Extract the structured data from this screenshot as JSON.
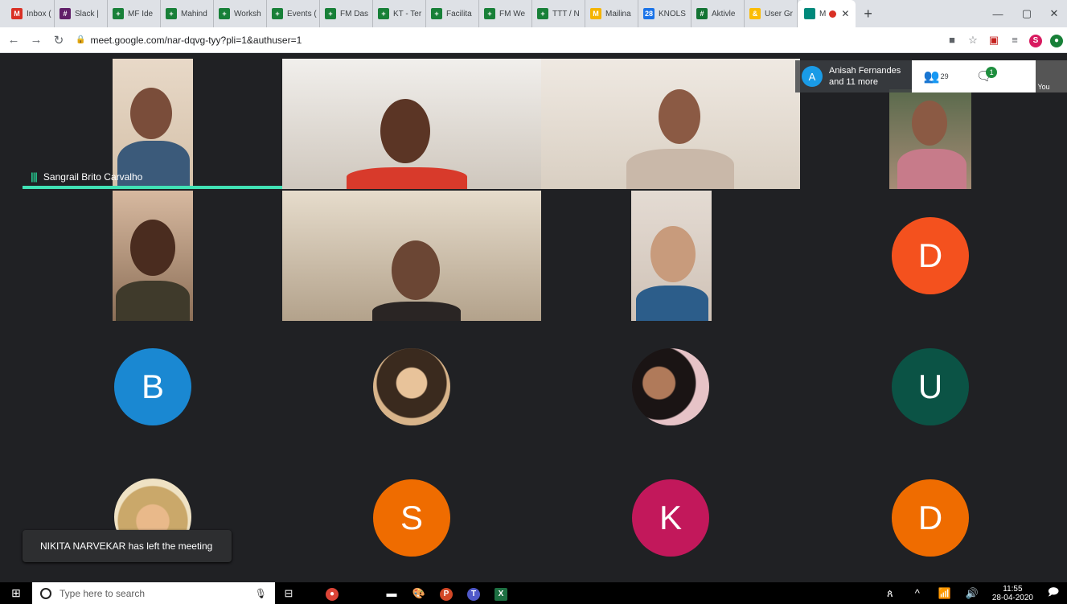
{
  "browser": {
    "tabs": [
      {
        "label": "Inbox (",
        "icon": "gmail-icon",
        "color": "#d93025",
        "glyph": "M"
      },
      {
        "label": "Slack | ",
        "icon": "slack-icon",
        "color": "#611f69",
        "glyph": "#"
      },
      {
        "label": "MF Ide",
        "icon": "sheets-icon",
        "color": "#188038",
        "glyph": "+"
      },
      {
        "label": "Mahind",
        "icon": "sheets-icon",
        "color": "#188038",
        "glyph": "+"
      },
      {
        "label": "Worksh",
        "icon": "sheets-icon",
        "color": "#188038",
        "glyph": "+"
      },
      {
        "label": "Events (",
        "icon": "sheets-icon",
        "color": "#188038",
        "glyph": "+"
      },
      {
        "label": "FM Das",
        "icon": "sheets-icon",
        "color": "#188038",
        "glyph": "+"
      },
      {
        "label": "KT - Ter",
        "icon": "sheets-icon",
        "color": "#188038",
        "glyph": "+"
      },
      {
        "label": "Facilita",
        "icon": "sheets-icon",
        "color": "#188038",
        "glyph": "+"
      },
      {
        "label": "FM We",
        "icon": "sheets-icon",
        "color": "#188038",
        "glyph": "+"
      },
      {
        "label": "TTT / N",
        "icon": "sheets-icon",
        "color": "#188038",
        "glyph": "+"
      },
      {
        "label": "Mailina",
        "icon": "mail-icon",
        "color": "#f4b400",
        "glyph": "M"
      },
      {
        "label": "KNOLS",
        "icon": "calendar-icon",
        "color": "#1a73e8",
        "glyph": "28"
      },
      {
        "label": "Aktivle",
        "icon": "app-icon",
        "color": "#137333",
        "glyph": "#"
      },
      {
        "label": "User Gr",
        "icon": "users-icon",
        "color": "#fbbc04",
        "glyph": "&"
      }
    ],
    "active_tab": {
      "label": "M",
      "icon": "meet-icon",
      "color": "#00897b"
    },
    "new_tab": "+",
    "url": "meet.google.com/nar-dqvg-tyy?pli=1&authuser=1",
    "profile_letter": "S"
  },
  "meet": {
    "active_speaker": "Sangrail Brito Carvalho",
    "others_name": "Anisah Fernandes",
    "others_more": "and 11 more",
    "others_avatar_letter": "A",
    "participants_count": "29",
    "chat_badge": "1",
    "self_label": "You",
    "avatars": [
      {
        "letter": "D",
        "color": "#f4511e"
      },
      {
        "letter": "B",
        "color": "#1a88d2"
      },
      {
        "letter": "U",
        "color": "#0b5345"
      },
      {
        "letter": "S",
        "color": "#ef6c00"
      },
      {
        "letter": "K",
        "color": "#c2185b"
      },
      {
        "letter": "D",
        "color": "#ef6c00"
      }
    ],
    "toast": "NIKITA NARVEKAR has left the meeting"
  },
  "taskbar": {
    "search_placeholder": "Type here to search",
    "time": "11:55",
    "date": "28-04-2020"
  }
}
